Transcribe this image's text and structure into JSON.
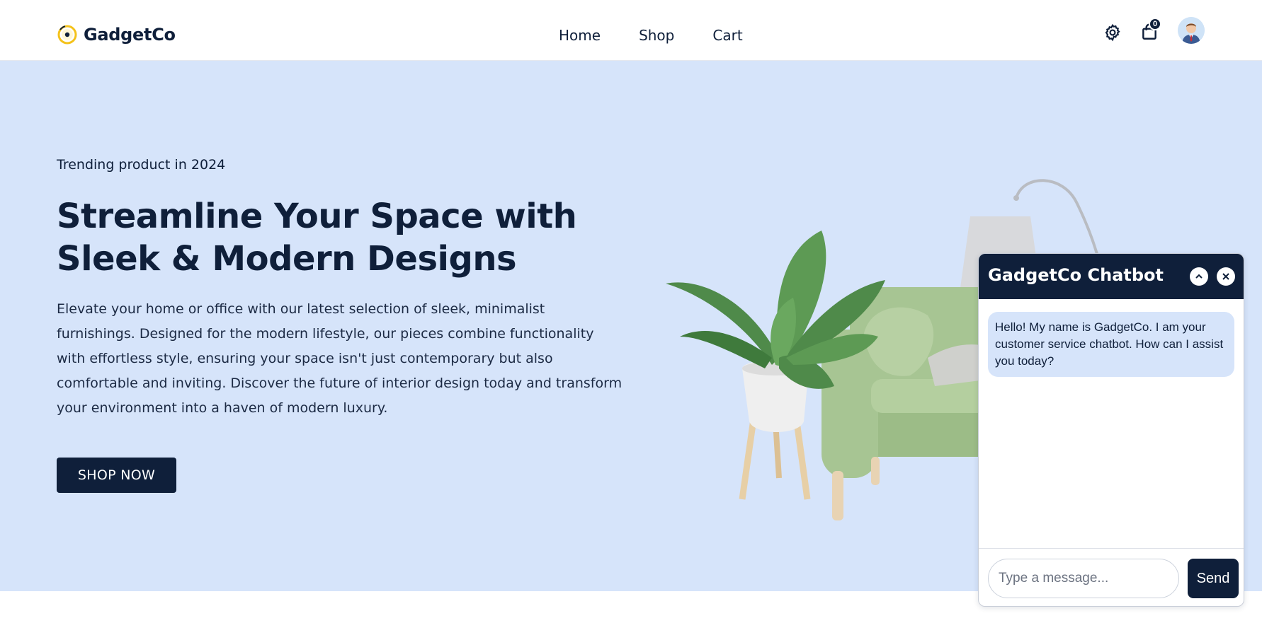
{
  "brand": {
    "name": "GadgetCo",
    "accent": "#f4c21a",
    "primary": "#0f1f3a"
  },
  "nav": {
    "items": [
      {
        "label": "Home"
      },
      {
        "label": "Shop"
      },
      {
        "label": "Cart"
      }
    ]
  },
  "header_icons": {
    "settings_icon": "gear-icon",
    "cart_icon": "shopping-bag-icon",
    "cart_count": "0",
    "avatar": "user-avatar"
  },
  "hero": {
    "eyebrow": "Trending product in 2024",
    "title": "Streamline Your Space with Sleek & Modern Designs",
    "description": "Elevate your home or office with our latest selection of sleek, minimalist furnishings. Designed for the modern lifestyle, our pieces combine functionality with effortless style, ensuring your space isn't just contemporary but also comfortable and inviting. Discover the future of interior design today and transform your environment into a haven of modern luxury.",
    "cta_label": "SHOP NOW",
    "background": "#d6e4fa"
  },
  "chatbot": {
    "title": "GadgetCo Chatbot",
    "messages": [
      {
        "from": "bot",
        "text": "Hello! My name is GadgetCo. I am your customer service chatbot. How can I assist you today?"
      }
    ],
    "input_placeholder": "Type a message...",
    "send_label": "Send"
  }
}
